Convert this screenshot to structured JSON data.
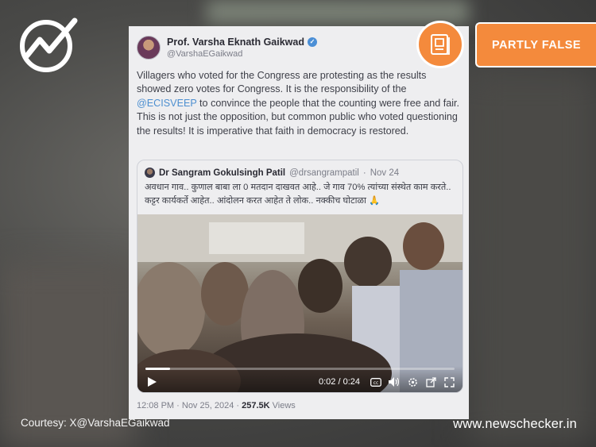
{
  "brand": {
    "logo_icon": "newschecker-logo-icon",
    "site_url": "www.newschecker.in",
    "courtesy": "Courtesy: X@VarshaEGaikwad",
    "accent_color": "#f48a3c"
  },
  "verdict": {
    "label": "PARTLY FALSE",
    "icon": "document-badge-icon"
  },
  "tweet": {
    "author_name": "Prof. Varsha Eknath Gaikwad",
    "handle": "@VarshaEGaikwad",
    "verified_icon": "verified-badge-icon",
    "text_part1": "Villagers who voted for the Congress are protesting as the results showed zero votes for Congress. It is the responsibility of the ",
    "mention": "@ECISVEEP",
    "text_part2": " to convince the people that the counting were free and fair. This is not just the opposition, but common public who voted questioning the results! It is imperative that faith in democracy is restored.",
    "time": "12:08 PM",
    "date": "Nov 25, 2024",
    "views_count": "257.5K",
    "views_label": "Views"
  },
  "quoted_tweet": {
    "author_name": "Dr Sangram Gokulsingh Patil",
    "handle": "@drsangrampatil",
    "date": "Nov 24",
    "text": "अवधान गाव.. कुणाल बाबा ला 0 मतदान दाखवत आहे.. जे गाव 70% त्यांच्या संस्थेत काम करते.. कट्टर कार्यकर्ते आहेत.. आंदोलन करत आहेत ते लोक.. नक्कीच घोटाळा 🙏",
    "video": {
      "current_time": "0:02",
      "duration": "0:24",
      "progress": 0.08
    }
  }
}
